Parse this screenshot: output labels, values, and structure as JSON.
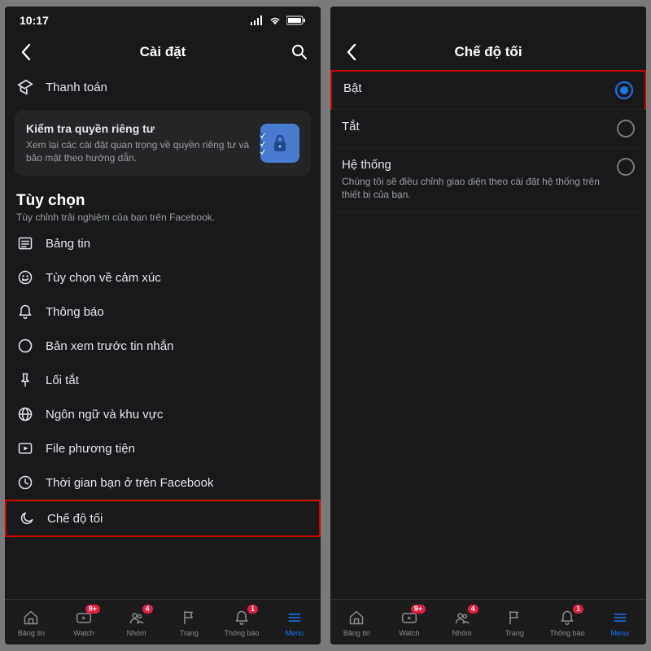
{
  "statusbar": {
    "time": "10:17"
  },
  "left": {
    "header": {
      "title": "Cài đặt"
    },
    "top_items": [
      {
        "icon": "ticket-icon",
        "label": "Thanh toán"
      }
    ],
    "card": {
      "title": "Kiểm tra quyền riêng tư",
      "sub": "Xem lại các cài đặt quan trọng về quyền riêng tư và bảo mật theo hướng dẫn."
    },
    "section": {
      "title": "Tùy chọn",
      "sub": "Tùy chỉnh trải nghiệm của bạn trên Facebook."
    },
    "items": [
      {
        "icon": "newsfeed-icon",
        "label": "Bảng tin"
      },
      {
        "icon": "emotion-icon",
        "label": "Tùy chọn về cảm xúc"
      },
      {
        "icon": "bell-icon",
        "label": "Thông báo"
      },
      {
        "icon": "message-preview-icon",
        "label": "Bản xem trước tin nhắn"
      },
      {
        "icon": "pin-icon",
        "label": "Lối tắt"
      },
      {
        "icon": "globe-icon",
        "label": "Ngôn ngữ và khu vực"
      },
      {
        "icon": "media-icon",
        "label": "File phương tiện"
      },
      {
        "icon": "clock-icon",
        "label": "Thời gian bạn ở trên Facebook"
      },
      {
        "icon": "moon-icon",
        "label": "Chế độ tối"
      }
    ]
  },
  "right": {
    "header": {
      "title": "Chế độ tối"
    },
    "options": [
      {
        "label": "Bật",
        "sub": "",
        "selected": true,
        "highlight": true
      },
      {
        "label": "Tắt",
        "sub": "",
        "selected": false,
        "highlight": false
      },
      {
        "label": "Hệ thống",
        "sub": "Chúng tôi sẽ điều chỉnh giao diện theo cài đặt hệ thống trên thiết bị của bạn.",
        "selected": false,
        "highlight": false
      }
    ]
  },
  "tabs": [
    {
      "icon": "home-icon",
      "label": "Bảng tin",
      "badge": ""
    },
    {
      "icon": "watch-icon",
      "label": "Watch",
      "badge": "9+"
    },
    {
      "icon": "group-icon",
      "label": "Nhóm",
      "badge": "4"
    },
    {
      "icon": "flag-icon",
      "label": "Trang",
      "badge": ""
    },
    {
      "icon": "bell-icon",
      "label": "Thông báo",
      "badge": "1"
    },
    {
      "icon": "menu-icon",
      "label": "Menu",
      "badge": "",
      "active": true
    }
  ]
}
